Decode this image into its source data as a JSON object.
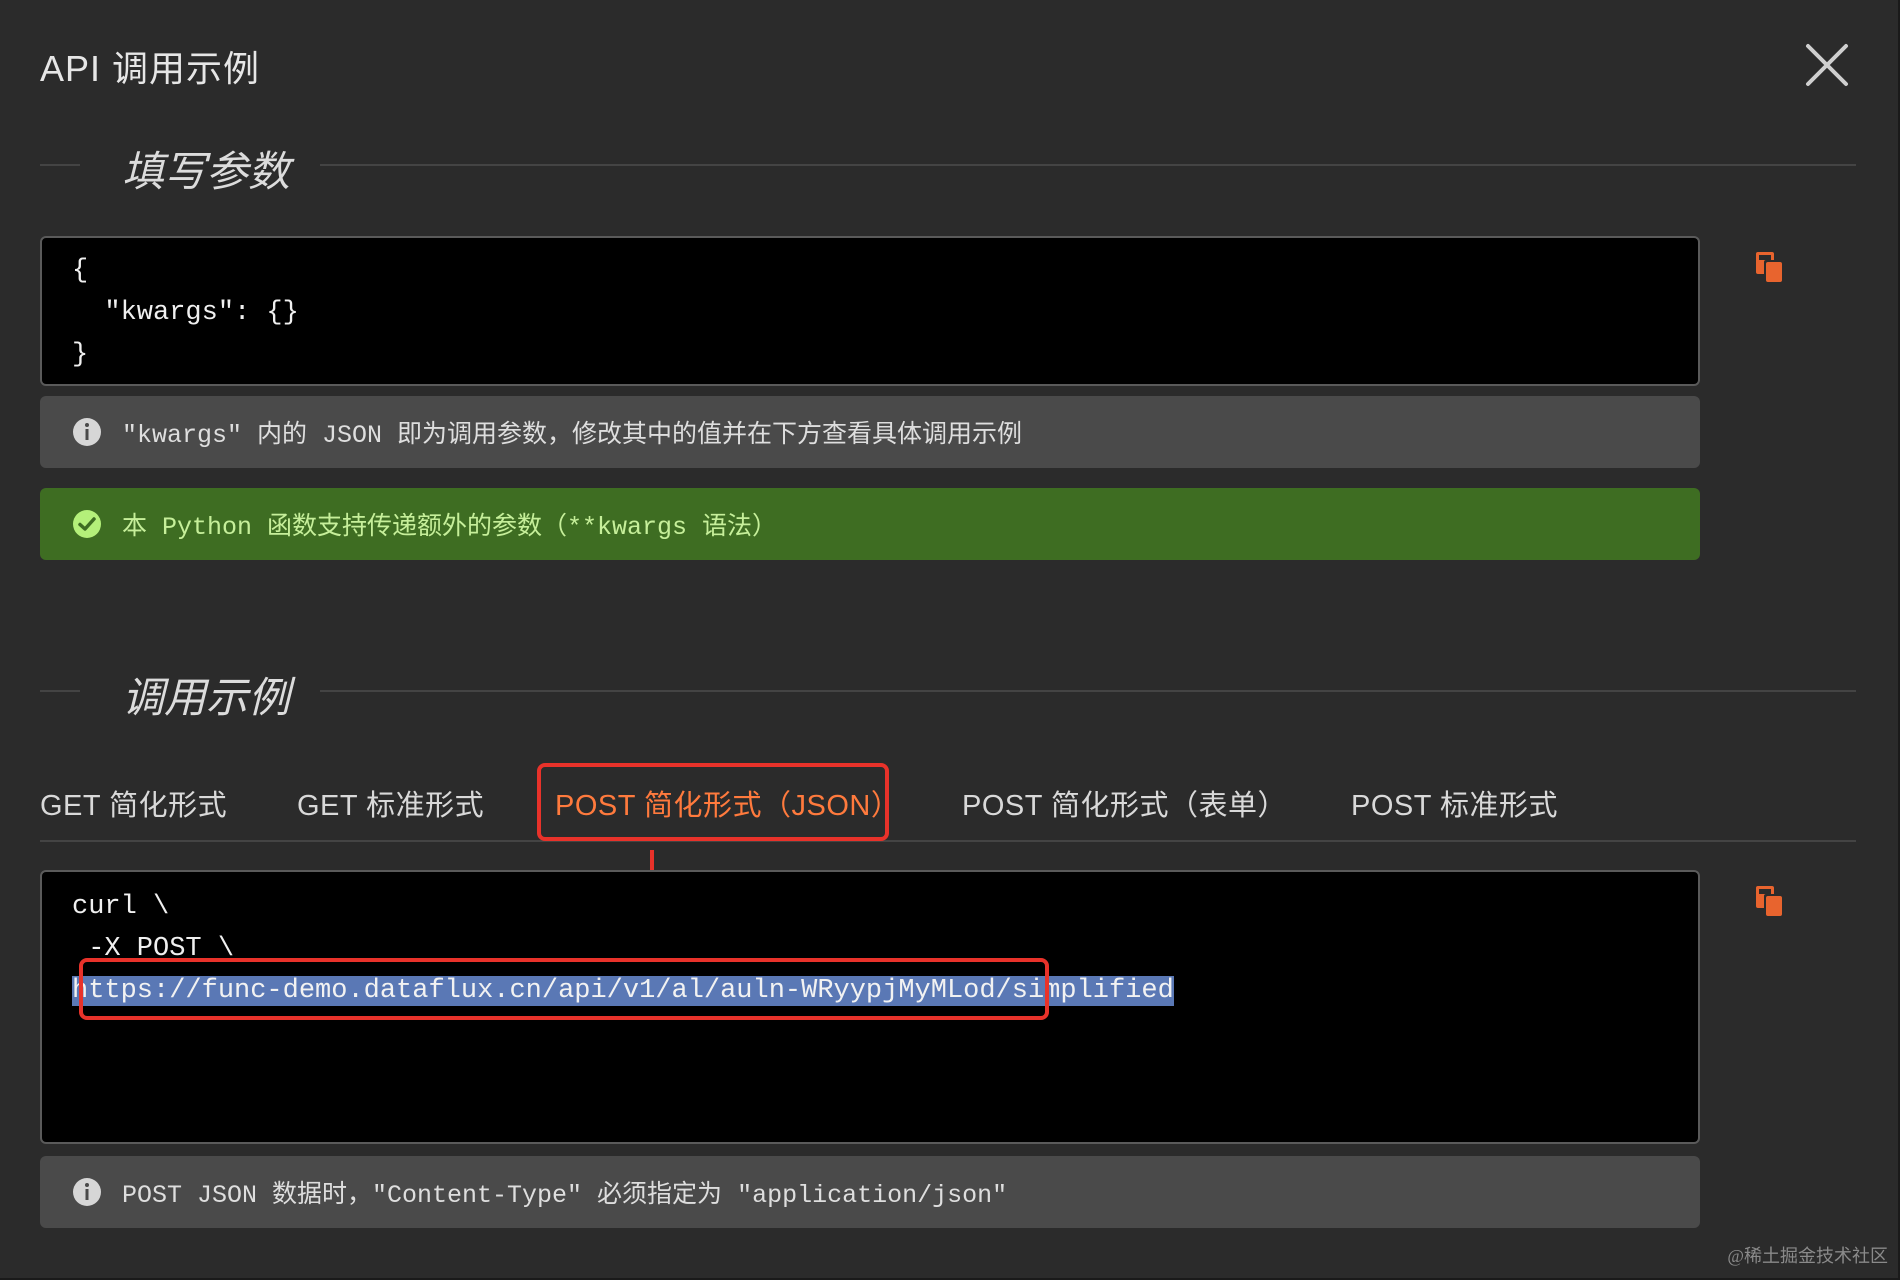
{
  "dialog": {
    "title": "API 调用示例",
    "close_icon": "close-icon"
  },
  "params_section": {
    "heading": "填写参数",
    "code_lines": [
      "{",
      "  \"kwargs\": {}",
      "}"
    ],
    "copy_icon": "copy-icon",
    "info_notice": "\"kwargs\" 内的 JSON 即为调用参数，修改其中的值并在下方查看具体调用示例",
    "success_notice": "本 Python 函数支持传递额外的参数（**kwargs 语法）"
  },
  "example_section": {
    "heading": "调用示例",
    "tabs": [
      {
        "label": "GET 简化形式",
        "active": false
      },
      {
        "label": "GET 标准形式",
        "active": false
      },
      {
        "label": "POST 简化形式（JSON）",
        "active": true
      },
      {
        "label": "POST 简化形式（表单）",
        "active": false
      },
      {
        "label": "POST 标准形式",
        "active": false
      }
    ],
    "code_lines": [
      "curl \\",
      " -X POST \\"
    ],
    "url": "https://func-demo.dataflux.cn/api/v1/al/auln-WRyypjMyMLod/simplified",
    "copy_icon": "copy-icon",
    "info_notice": "POST JSON 数据时，\"Content-Type\" 必须指定为 \"application/json\""
  },
  "colors": {
    "accent": "#ff7a3d",
    "annotation_red": "#e8322a",
    "success_bg": "#3e6d22",
    "selection": "#5a78b5"
  },
  "watermark": "@稀土掘金技术社区"
}
